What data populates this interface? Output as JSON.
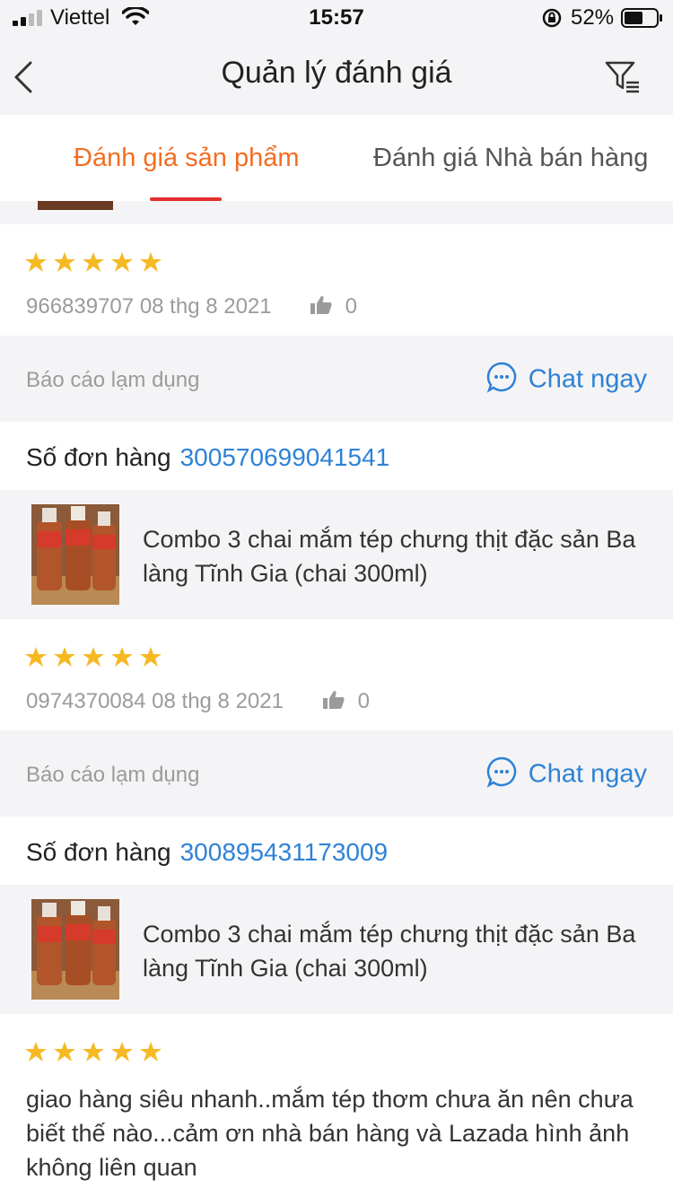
{
  "status_bar": {
    "carrier": "Viettel",
    "time": "15:57",
    "battery": "52%"
  },
  "header": {
    "title": "Quản lý đánh giá"
  },
  "tabs": [
    {
      "label": "Đánh giá sản phẩm",
      "active": true
    },
    {
      "label": "Đánh giá Nhà bán hàng",
      "active": false
    }
  ],
  "colors": {
    "accent": "#f36d21",
    "underline": "#e42e2e",
    "link": "#2e82d6",
    "star": "#f5b924"
  },
  "reviews": [
    {
      "rating": 5,
      "reviewer": "966839707",
      "date": "08 thg 8 2021",
      "likes": "0",
      "report_label": "Báo cáo lạm dụng",
      "chat_label": "Chat ngay"
    },
    {
      "order_label": "Số đơn hàng",
      "order_number": "300570699041541",
      "product_name": "Combo 3 chai mắm tép chưng thịt đặc sản Ba làng Tĩnh Gia (chai 300ml)",
      "rating": 5,
      "reviewer": "0974370084",
      "date": "08 thg 8 2021",
      "likes": "0",
      "report_label": "Báo cáo lạm dụng",
      "chat_label": "Chat ngay"
    },
    {
      "order_label": "Số đơn hàng",
      "order_number": "300895431173009",
      "product_name": "Combo 3 chai mắm tép chưng thịt đặc sản Ba làng Tĩnh Gia (chai 300ml)",
      "rating": 5,
      "comment": "giao hàng siêu nhanh..mắm tép thơm chưa ăn nên chưa biết thế nào...cảm ơn nhà bán hàng và Lazada hình ảnh không liên quan"
    }
  ]
}
